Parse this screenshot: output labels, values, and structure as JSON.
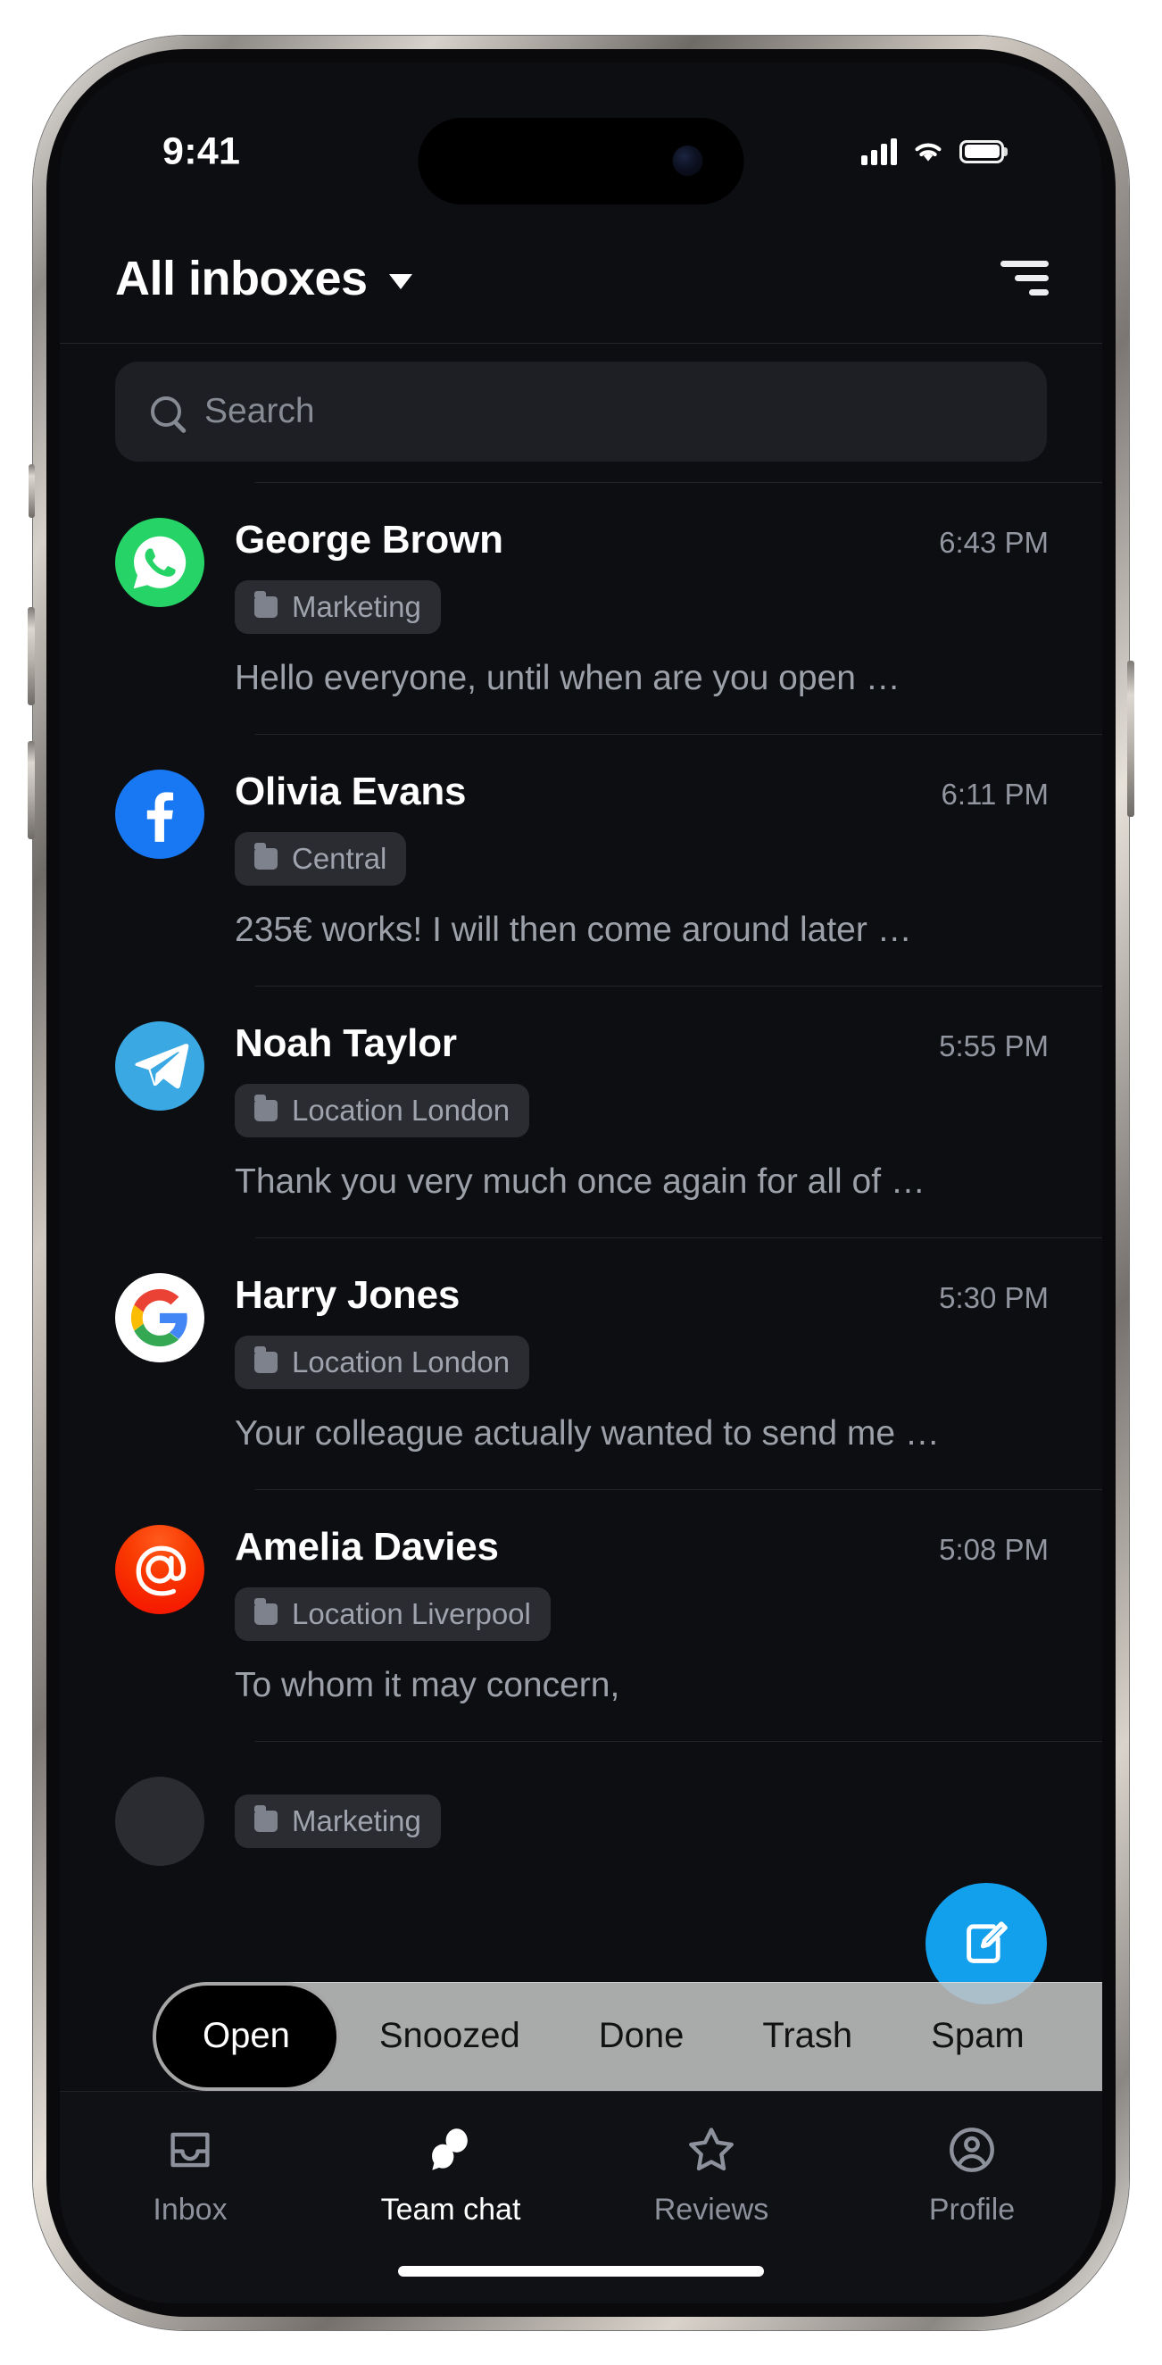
{
  "status_bar": {
    "time": "9:41",
    "icons": [
      "cellular-signal-icon",
      "wifi-icon",
      "battery-icon"
    ]
  },
  "header": {
    "title": "All inboxes",
    "dropdown_icon": "chevron-down-icon",
    "filter_icon": "filter-icon"
  },
  "search": {
    "placeholder": "Search",
    "value": "",
    "icon": "search-icon"
  },
  "conversations": [
    {
      "channel": "whatsapp",
      "avatar_icon": "whatsapp-icon",
      "avatar_color": "#25D366",
      "name": "George Brown",
      "time": "6:43 PM",
      "tag": "Marketing",
      "tag_icon": "folder-icon",
      "preview": "Hello everyone, until when are you open …"
    },
    {
      "channel": "facebook",
      "avatar_icon": "facebook-icon",
      "avatar_color": "#1877F2",
      "name": "Olivia Evans",
      "time": "6:11 PM",
      "tag": "Central",
      "tag_icon": "folder-icon",
      "preview": "235€ works! I will then come around later …"
    },
    {
      "channel": "telegram",
      "avatar_icon": "telegram-icon",
      "avatar_color": "#3AA8E2",
      "name": "Noah Taylor",
      "time": "5:55 PM",
      "tag": "Location London",
      "tag_icon": "folder-icon",
      "preview": "Thank you very much once again for all of …"
    },
    {
      "channel": "google",
      "avatar_icon": "google-icon",
      "avatar_color": "#FFFFFF",
      "name": "Harry Jones",
      "time": "5:30 PM",
      "tag": "Location London",
      "tag_icon": "folder-icon",
      "preview": "Your colleague actually wanted to send me …"
    },
    {
      "channel": "email",
      "avatar_icon": "at-sign-icon",
      "avatar_color": "#F40E00",
      "name": "Amelia Davies",
      "time": "5:08 PM",
      "tag": "Location Liverpool",
      "tag_icon": "folder-icon",
      "preview": "To whom it may concern,"
    },
    {
      "channel": "partial",
      "avatar_icon": "folder-icon",
      "avatar_color": "#2A2C31",
      "name": "",
      "time": "",
      "tag": "Marketing",
      "tag_icon": "folder-icon",
      "preview": ""
    }
  ],
  "compose_fab": {
    "icon": "compose-pencil-icon",
    "color": "#12A0ED"
  },
  "segmented_control": {
    "selected": "Open",
    "options": [
      "Open",
      "Snoozed",
      "Done",
      "Trash",
      "Spam"
    ]
  },
  "bottom_nav": {
    "active": "Team chat",
    "items": [
      {
        "label": "Inbox",
        "icon": "inbox-tray-icon"
      },
      {
        "label": "Team chat",
        "icon": "chat-bubbles-icon"
      },
      {
        "label": "Reviews",
        "icon": "star-icon"
      },
      {
        "label": "Profile",
        "icon": "person-circle-icon"
      }
    ]
  }
}
